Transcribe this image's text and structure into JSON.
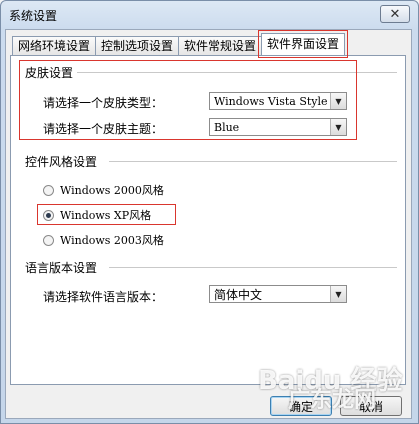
{
  "window": {
    "title": "系统设置",
    "close_glyph": "✕"
  },
  "tabs": [
    {
      "label": "网络环境设置"
    },
    {
      "label": "控制选项设置"
    },
    {
      "label": "软件常规设置"
    },
    {
      "label": "软件界面设置",
      "active": true
    }
  ],
  "skin": {
    "group_label": "皮肤设置",
    "type_label": "请选择一个皮肤类型：",
    "type_value": "Windows Vista Style",
    "theme_label": "请选择一个皮肤主题：",
    "theme_value": "Blue"
  },
  "control_style": {
    "group_label": "控件风格设置",
    "options": [
      {
        "label": "Windows 2000风格",
        "checked": false
      },
      {
        "label": "Windows XP风格",
        "checked": true
      },
      {
        "label": "Windows 2003风格",
        "checked": false
      }
    ]
  },
  "language": {
    "group_label": "语言版本设置",
    "label": "请选择软件语言版本：",
    "value": "简体中文"
  },
  "buttons": {
    "ok": "确定",
    "cancel": "取消"
  },
  "watermark": {
    "top": "Baidu 经验",
    "bottom": "广东龙网"
  },
  "colors": {
    "highlight": "#d9362e",
    "accent": "#3c7fb1"
  }
}
